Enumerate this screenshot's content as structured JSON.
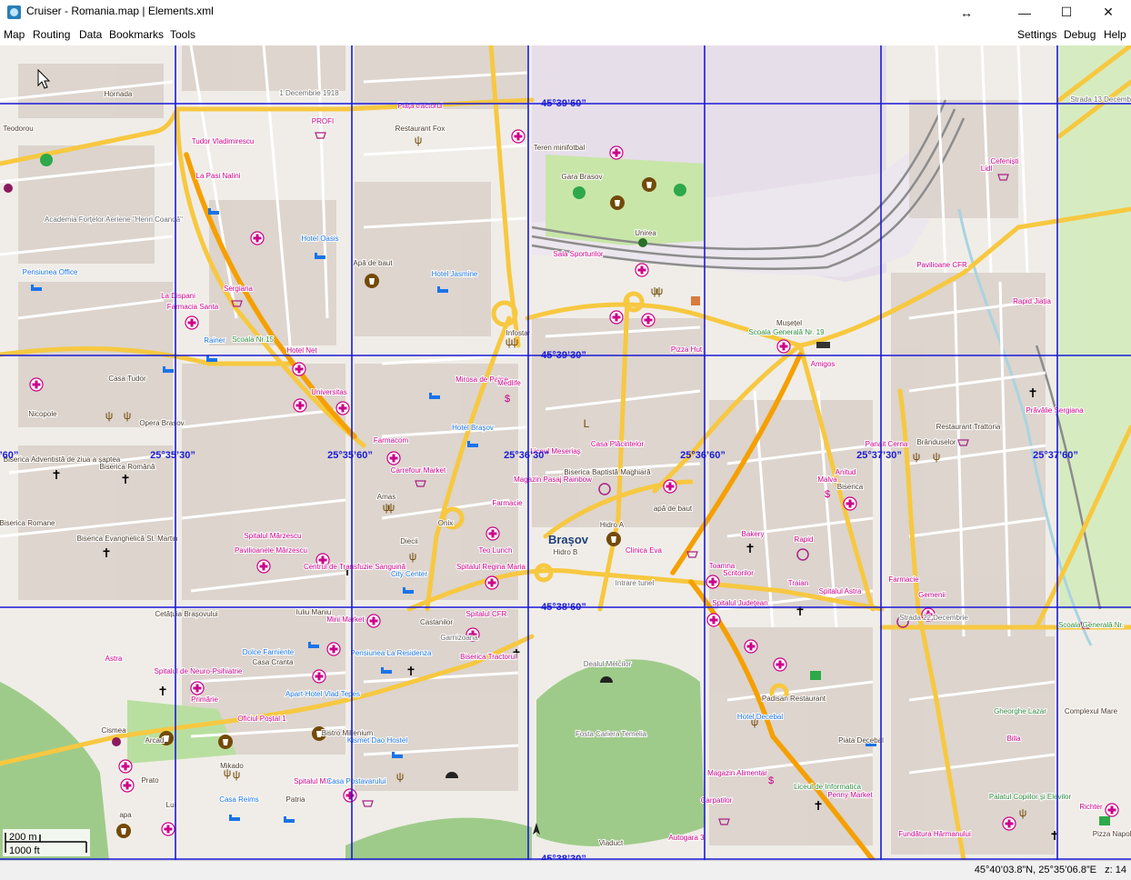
{
  "window": {
    "title": "Cruiser - Romania.map | Elements.xml",
    "resize_glyph": "↔",
    "minimize_glyph": "—",
    "maximize_glyph": "☐",
    "close_glyph": "✕"
  },
  "menu": {
    "left": [
      "Map",
      "Routing",
      "Data",
      "Bookmarks",
      "Tools"
    ],
    "right": [
      "Settings",
      "Debug",
      "Help"
    ]
  },
  "map": {
    "grid_lat_labels": [
      "45°39’60”",
      "45°39’30”",
      "45°38’60”",
      "45°38’30”"
    ],
    "grid_lon_labels": [
      "’60”",
      "25°35’30”",
      "25°35’60”",
      "25°36’30”",
      "25°36’60”",
      "25°37’30”",
      "25°37’60”"
    ],
    "city_name": "Brașov",
    "labels": [
      "Teodorou",
      "Hornada",
      "Tudor Vladimirescu",
      "La Pasi Nalini",
      "Academia Forțelor Aeriene \"Henri Coandă\"",
      "Pensiunea Office",
      "La Dispani",
      "Farmacia Santa",
      "Rainer",
      "Scoala Nr.15",
      "Casa Tudor",
      "Nicopole",
      "Opera Brasov",
      "Biserica Adventistă de ziua a șaptea",
      "Biserica Română",
      "Biserica Romane",
      "Biserica Evanghelică St. Martin",
      "Cetățuia Brașovului",
      "Astra",
      "Spitalul de Neuro-Psihiatrie",
      "Primărie",
      "Cismea",
      "Arcad",
      "Prato",
      "Lui",
      "apa",
      "1 Decembrie 1918",
      "Piața tractorul",
      "PROFI",
      "Restaurant Fox",
      "Hotel Oasis",
      "Apă de baut",
      "Hotel Jasmine",
      "Sergiana",
      "Hotel Net",
      "Universitas",
      "Mirosa de Paine",
      "Medlife",
      "Hotel Brașov",
      "Farmacom",
      "Carrefour Market",
      "Amas",
      "Onix",
      "Farmacie",
      "Diecii",
      "Teo Lunch",
      "City Center",
      "Spitalul Mărzescu",
      "Pavilioanele Mărzescu",
      "Centrul de Transfuzie Sanguină",
      "Spitalul Regina Maria",
      "Iuliu Maniu",
      "Mini Market",
      "Castanilor",
      "Spitalul CFR",
      "Dolce Farniente",
      "Casa Cranta",
      "Pensiunea La Residenza",
      "Apart-Hotel Vlad Tepes",
      "Oficiul Poștal 1",
      "Bistro Millenium",
      "Kismet Dao Hostel",
      "Mikado",
      "Spitalul Militar",
      "Casa Postavarului",
      "Casa Reims",
      "Patria",
      "Garnizoana",
      "Biserica Tractorul",
      "Teren minifotbal",
      "Gara Brasov",
      "Unirea",
      "Sala Sporturilor",
      "Mușețel",
      "Scoala Generală Nr. 19",
      "Pizza Hut",
      "Infostar",
      "Casa Plăcintelor",
      "Liceul Meseriaș",
      "Magazin Pasaj Rainbow",
      "Biserica Baptistă Maghiară",
      "apă de baut",
      "Hidro A",
      "Hidro B",
      "Clinica Eva",
      "Intrare tunel",
      "Dealul Melcilor",
      "Fosta Cariera Temelia",
      "Viaduct",
      "Amigos",
      "Anitud",
      "Malva",
      "Biserica",
      "Bakery",
      "Rapid",
      "Toamna",
      "Scritorilor",
      "Traian",
      "Spitalul Astra",
      "Spitalul Județean",
      "Padisan Restaurant",
      "Hotel Decebal",
      "Piata Decebal",
      "Magazin Alimentar",
      "Liceul de Informatica",
      "Penny Market",
      "Carpatilor",
      "Autogara 3",
      "Lidl",
      "Cefeniști",
      "Pavilioane CFR",
      "Rapid Jiația",
      "Prăvălie Sergiana",
      "Restaurant Trattoria",
      "Brânduselor",
      "Panait Cerna",
      "Farmacie",
      "Gemenii",
      "Strada 22 Decembrie",
      "Scoala Generală Nr.",
      "Gheorghe Lazar",
      "Complexul Mare",
      "Billa",
      "Palatul Copiilor și Elevilor",
      "Richter",
      "Pizza Napoli",
      "Fundătura Hărmanului",
      "Strada 13 Decembrie"
    ],
    "scale_metric": "200 m",
    "scale_imperial": "1000 ft"
  },
  "status": {
    "coords": "45°40’03.8”N, 25°35’06.8”E",
    "zoom": "z: 14"
  },
  "colors": {
    "grid": "#1a1ad8",
    "major_road": "#f5b100",
    "primary_road": "#f7c840",
    "minor_road": "#ffffff",
    "building": "#d9d0c9",
    "park": "#c8e6a8",
    "forest": "#9fcb8a",
    "rail": "#8c8c8c",
    "water": "#aad3df",
    "poi_pink": "#cc0088",
    "poi_blue": "#1a73e8",
    "poi_brown": "#734a08",
    "industrial": "#e6dee9"
  }
}
